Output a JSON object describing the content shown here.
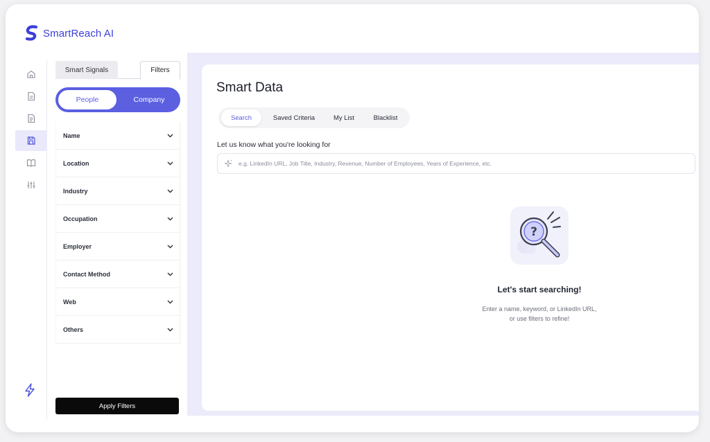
{
  "app": {
    "name": "SmartReach AI",
    "colors": {
      "accent": "#5b5fe0",
      "brand": "#3b3fd8",
      "dark": "#0a0a0a"
    }
  },
  "rail": {
    "items": [
      {
        "icon": "home-icon"
      },
      {
        "icon": "document-icon"
      },
      {
        "icon": "file-list-icon"
      },
      {
        "icon": "save-icon",
        "active": true
      },
      {
        "icon": "book-icon"
      },
      {
        "icon": "sliders-icon"
      }
    ],
    "bottom_icon": "lightning-icon"
  },
  "filters": {
    "tabs": [
      "Smart Signals",
      "Filters"
    ],
    "active_tab": "Filters",
    "toggle": {
      "people": "People",
      "company": "Company",
      "selected": "People"
    },
    "items": [
      "Name",
      "Location",
      "Industry",
      "Occupation",
      "Employer",
      "Contact Method",
      "Web",
      "Others"
    ],
    "apply_label": "Apply Filters"
  },
  "main": {
    "title": "Smart Data",
    "tabs": [
      "Search",
      "Saved Criteria",
      "My List",
      "Blacklist"
    ],
    "active_tab": "Search",
    "search": {
      "label": "Let us know what you're looking for",
      "placeholder": "e.g. LinkedIn URL, Job Title, Industry, Revenue, Number of Employees, Years of Experience, etc."
    },
    "empty_state": {
      "title": "Let's start searching!",
      "text": "Enter a name, keyword, or LinkedIn URL, or use filters to refine!"
    }
  }
}
